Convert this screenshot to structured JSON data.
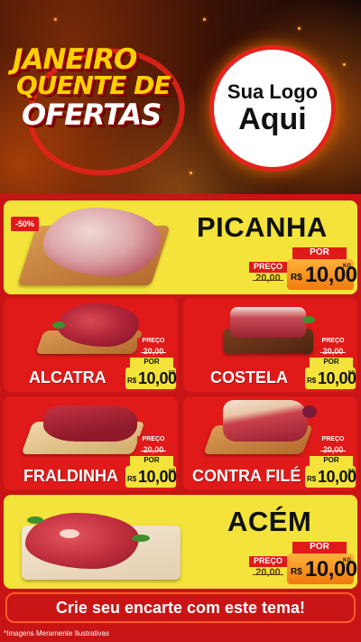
{
  "header": {
    "title_line1": "JANEIRO",
    "title_line2": "QUENTE DE",
    "title_line3": "OFERTAS",
    "logo_line1": "Sua Logo",
    "logo_line2": "Aqui"
  },
  "colors": {
    "panel_red": "#c81414",
    "card_red": "#e01919",
    "card_yellow": "#f3e33a",
    "price_orange": "#f07a10"
  },
  "labels": {
    "old_price_label": "PREÇO",
    "new_price_label": "POR",
    "currency": "R$",
    "unit": "KG"
  },
  "products": [
    {
      "name": "PICANHA",
      "discount_badge": "-50%",
      "old_price": "20,00",
      "new_price": "10,00"
    },
    {
      "name": "ALCATRA",
      "old_price": "20,00",
      "new_price": "10,00"
    },
    {
      "name": "COSTELA",
      "old_price": "20,00",
      "new_price": "10,00"
    },
    {
      "name": "FRALDINHA",
      "old_price": "20,00",
      "new_price": "10,00"
    },
    {
      "name": "CONTRA FILÉ",
      "old_price": "20,00",
      "new_price": "10,00"
    },
    {
      "name": "ACÉM",
      "old_price": "20,00",
      "new_price": "10,00"
    }
  ],
  "cta_text": "Crie seu encarte com este tema!",
  "footnote": "*Imagens Meramente Ilustrativas"
}
